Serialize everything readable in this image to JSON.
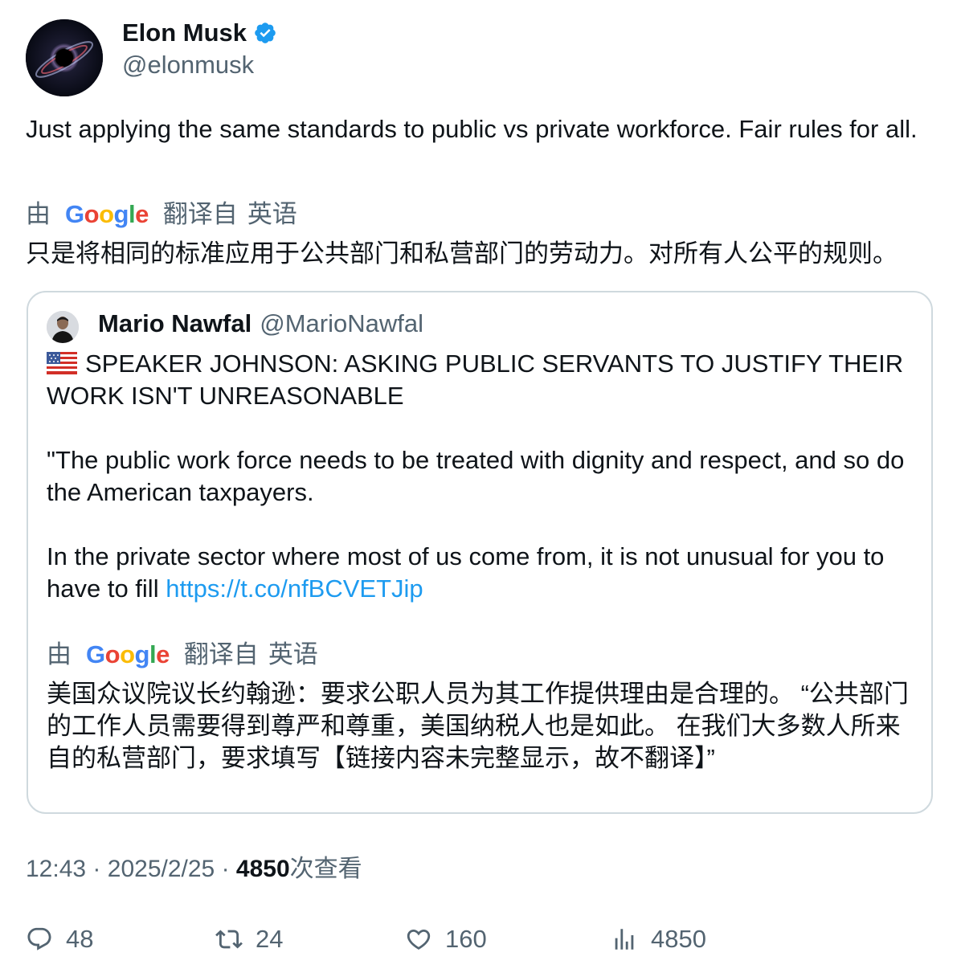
{
  "author": {
    "name": "Elon Musk",
    "handle": "@elonmusk",
    "verified_icon": "verified-badge-icon",
    "avatar_icon": "avatar-image"
  },
  "tweet": {
    "text": "Just applying the same standards to public vs private workforce. Fair rules for all.",
    "translation": {
      "prefix": "由",
      "provider": "Google",
      "suffix_1": "翻译自",
      "suffix_2": "英语",
      "text": "只是将相同的标准应用于公共部门和私营部门的劳动力。对所有人公平的规则。"
    }
  },
  "quote": {
    "name": "Mario Nawfal",
    "handle": "@MarioNawfal",
    "flag_icon": "us-flag-icon",
    "headline": "SPEAKER JOHNSON: ASKING PUBLIC SERVANTS TO JUSTIFY THEIR WORK ISN'T UNREASONABLE",
    "para1": "\"The public work force needs to be treated with dignity and respect, and so do the American taxpayers.",
    "para2_prefix": "In the private sector where most of us come from, it is not unusual for you to have to fill ",
    "link": "https://t.co/nfBCVETJip",
    "translation": {
      "prefix": "由",
      "provider": "Google",
      "suffix_1": "翻译自",
      "suffix_2": "英语",
      "text": "美国众议院议长约翰逊：要求公职人员为其工作提供理由是合理的。 “公共部门的工作人员需要得到尊严和尊重，美国纳税人也是如此。 在我们大多数人所来自的私营部门，要求填写【链接内容未完整显示，故不翻译】”"
    }
  },
  "meta": {
    "time": "12:43",
    "separator": "·",
    "date": "2025/2/25",
    "views": "4850",
    "views_label": "次查看"
  },
  "actions": {
    "reply": "48",
    "retweet": "24",
    "like": "160",
    "views": "4850"
  },
  "colors": {
    "text": "#0f1419",
    "muted": "#536471",
    "link": "#1d9bf0",
    "border": "#cfd9de"
  }
}
